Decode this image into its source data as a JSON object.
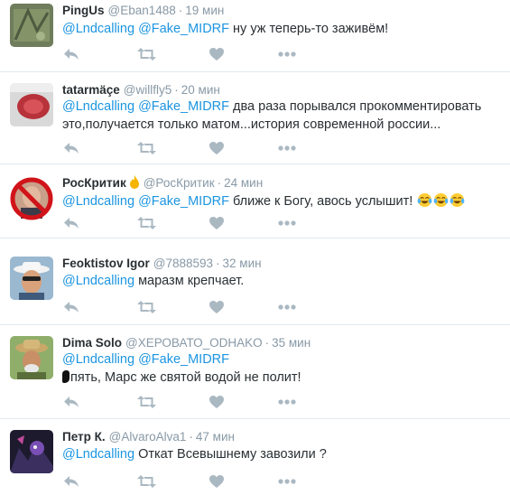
{
  "colors": {
    "mention": "#1b95e0",
    "muted": "#8899a6",
    "action": "#aab8c2",
    "divider": "#e1e8ed"
  },
  "tweets": [
    {
      "name": "PingUs",
      "handle": "@Eban1488",
      "time": "19 мин",
      "mentions": [
        "@Lndcalling",
        "@Fake_MIDRF"
      ],
      "text": "ну уж теперь-то заживём!",
      "avatar": "green-texture-avatar"
    },
    {
      "name": "tatarmäçe",
      "handle": "@willfly5",
      "time": "20 мин",
      "mentions": [
        "@Lndcalling",
        "@Fake_MIDRF"
      ],
      "text": "два раза порывался прокомментировать это,получается только матом...история современной россии...",
      "avatar": "red-emblem-avatar"
    },
    {
      "name": "РосКритик",
      "handle": "@РосКритик",
      "time": "24 мин",
      "mentions": [
        "@Lndcalling",
        "@Fake_MIDRF"
      ],
      "text": "ближе к Богу, авось услышит!",
      "emojis": [
        "tears-of-joy-emoji",
        "tears-of-joy-emoji",
        "tears-of-joy-emoji"
      ],
      "avatar": "prohibited-face-avatar"
    },
    {
      "name": "Feoktistov Igor",
      "handle": "@7888593",
      "time": "32 мин",
      "mentions": [
        "@Lndcalling"
      ],
      "text": "маразм крепчает.",
      "avatar": "man-in-hat-avatar"
    },
    {
      "name": "Dima Solo",
      "handle": "@ХЕРОВАТО_ODHAKO",
      "time": "35 мин",
      "mentions": [
        "@Lndcalling",
        "@Fake_MIDRF"
      ],
      "text": "пять, Марс же святой водой не полит!",
      "avatar": "old-man-hat-avatar"
    },
    {
      "name": "Петр К.",
      "handle": "@AlvaroAlva1",
      "time": "47 мин",
      "mentions": [
        "@Lndcalling"
      ],
      "text": "Откат Всевышнему завозили ?",
      "avatar": "dark-illustration-avatar"
    }
  ]
}
